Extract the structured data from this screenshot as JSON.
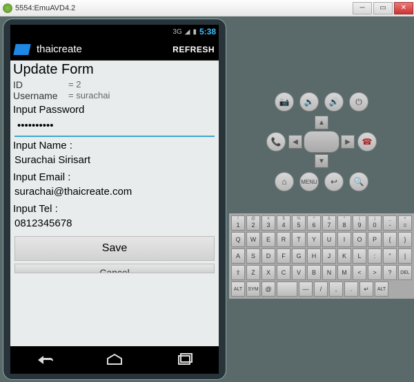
{
  "window": {
    "title": "5554:EmuAVD4.2"
  },
  "status": {
    "net": "3G",
    "time": "5:38"
  },
  "header": {
    "app": "thaicreate",
    "refresh": "REFRESH"
  },
  "form": {
    "title": "Update Form",
    "id_label": "ID",
    "id_value": "= 2",
    "user_label": "Username",
    "user_value": "= surachai",
    "pw_label": "Input Password",
    "pw_value": "••••••••••",
    "name_label": "Input Name :",
    "name_value": "Surachai Sirisart",
    "email_label": "Input Email :",
    "email_value": "surachai@thaicreate.com",
    "tel_label": "Input Tel :",
    "tel_value": "0812345678",
    "save": "Save",
    "cancel": "Cancel"
  },
  "controls": {
    "menu": "MENU"
  },
  "kbd": {
    "r1sup": [
      "!",
      "@",
      "#",
      "$",
      "%",
      "^",
      "&",
      "*",
      "(",
      ")",
      "_",
      "+"
    ],
    "r1": [
      "1",
      "2",
      "3",
      "4",
      "5",
      "6",
      "7",
      "8",
      "9",
      "0",
      "-",
      "="
    ],
    "r2": [
      "Q",
      "W",
      "E",
      "R",
      "T",
      "Y",
      "U",
      "I",
      "O",
      "P",
      "{",
      "}"
    ],
    "r3": [
      "A",
      "S",
      "D",
      "F",
      "G",
      "H",
      "J",
      "K",
      "L",
      ":",
      "\"",
      "|"
    ],
    "r4pre": "⇧",
    "r4": [
      "Z",
      "X",
      "C",
      "V",
      "B",
      "N",
      "M",
      "<",
      ">",
      "?"
    ],
    "r4del": "DEL",
    "r5": [
      "ALT",
      "SYM",
      "@",
      " ",
      "—",
      "/",
      ",",
      ".",
      "↵",
      "ALT"
    ]
  }
}
